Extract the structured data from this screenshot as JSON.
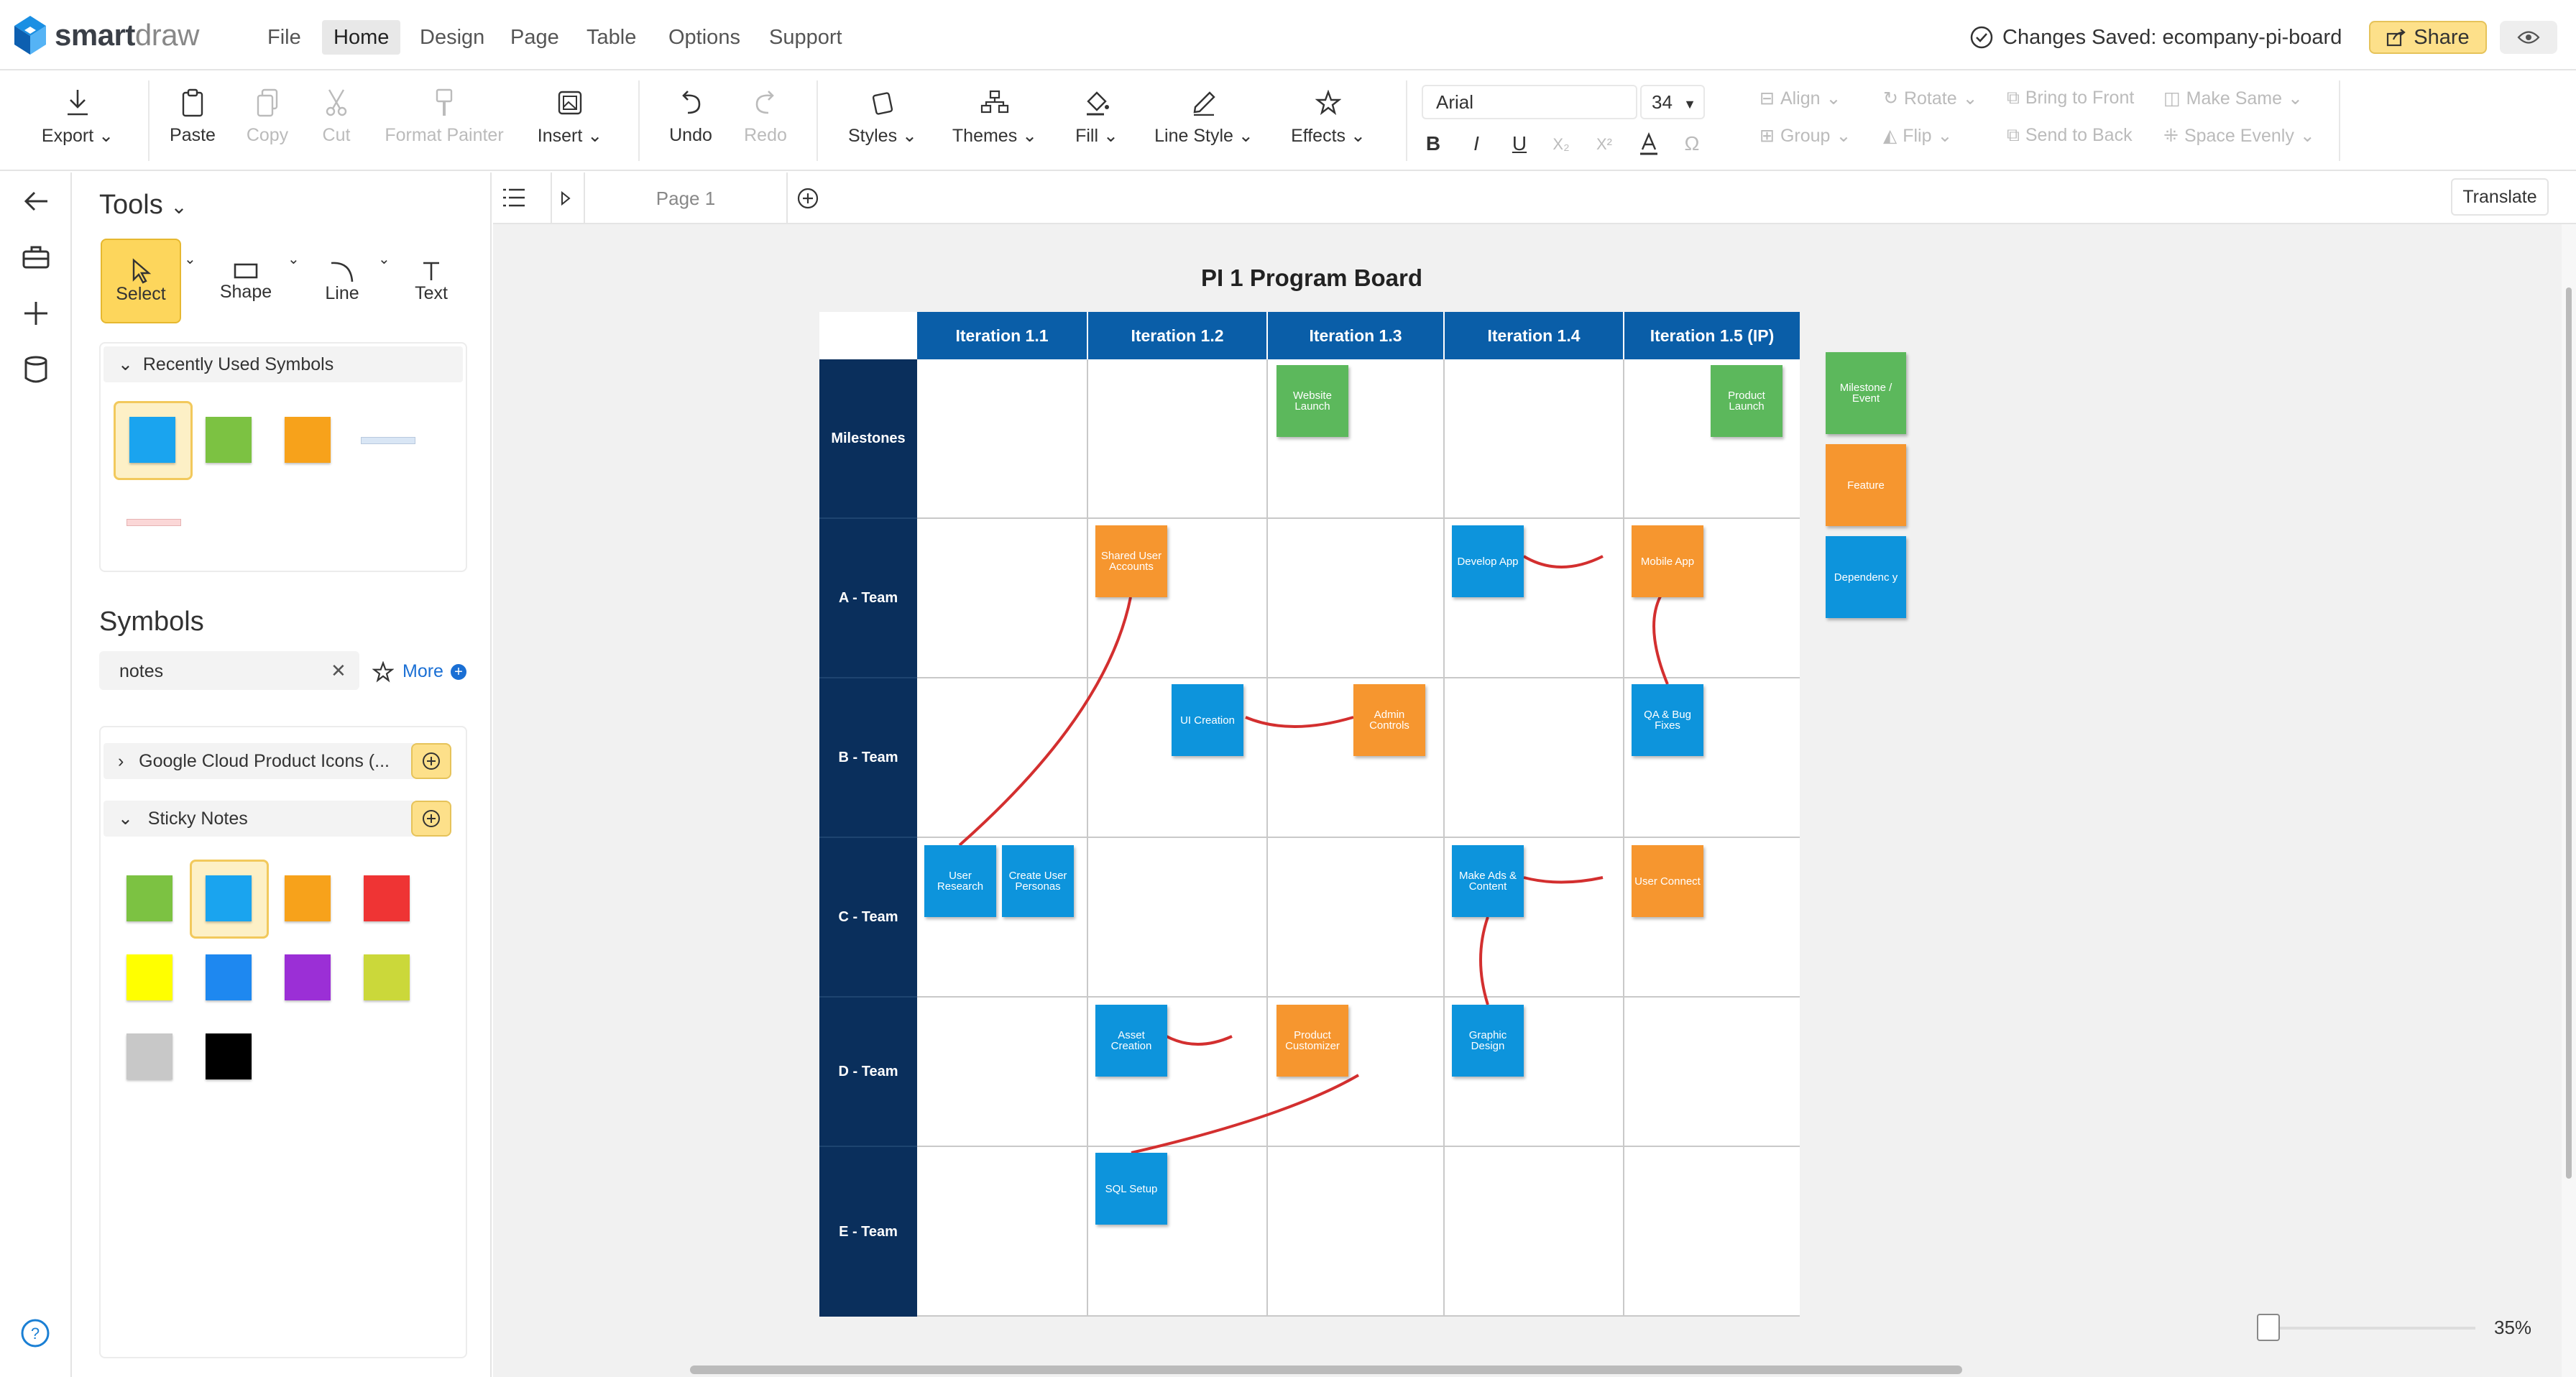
{
  "app": {
    "brand_bold": "smart",
    "brand_light": "draw"
  },
  "menu": [
    "File",
    "Home",
    "Design",
    "Page",
    "Table",
    "Options",
    "Support"
  ],
  "status": {
    "saved_text": "Changes Saved: ecompany-pi-board",
    "share_label": "Share"
  },
  "toolbar": {
    "export": "Export",
    "paste": "Paste",
    "copy": "Copy",
    "cut": "Cut",
    "format_painter": "Format Painter",
    "insert": "Insert",
    "undo": "Undo",
    "redo": "Redo",
    "styles": "Styles",
    "themes": "Themes",
    "fill": "Fill",
    "line_style": "Line Style",
    "effects": "Effects",
    "font_family": "Arial",
    "font_size": "34",
    "align": "Align",
    "rotate": "Rotate",
    "bring_front": "Bring to Front",
    "make_same": "Make Same",
    "group": "Group",
    "flip": "Flip",
    "send_back": "Send to Back",
    "space_evenly": "Space Evenly"
  },
  "panel": {
    "tools_title": "Tools",
    "tools": [
      "Select",
      "Shape",
      "Line",
      "Text"
    ],
    "recent_title": "Recently Used Symbols",
    "symbols_title": "Symbols",
    "search_value": "notes",
    "more_label": "More",
    "lib1": "Google Cloud Product Icons (...",
    "lib2": "Sticky Notes",
    "note_colors": [
      "#7cc242",
      "#1aa4ef",
      "#f7a21b",
      "#ef3434",
      "#ffff00",
      "#1e88f0",
      "#9b2fd6",
      "#cbd83a",
      "#c8c8c8",
      "#000000"
    ],
    "recent_colors": [
      "#1aa4ef",
      "#7cc242",
      "#f7a21b"
    ]
  },
  "tabs": {
    "page_label": "Page 1",
    "translate": "Translate"
  },
  "board": {
    "title": "PI 1 Program Board",
    "columns": [
      "Iteration 1.1",
      "Iteration 1.2",
      "Iteration 1.3",
      "Iteration 1.4",
      "Iteration 1.5 (IP)"
    ],
    "rows": [
      "Milestones",
      "A - Team",
      "B - Team",
      "C - Team",
      "D - Team",
      "E - Team"
    ],
    "stickies": {
      "website_launch": "Website Launch",
      "product_launch": "Product Launch",
      "shared_user_accounts": "Shared User Accounts",
      "develop_app": "Develop App",
      "mobile_app": "Mobile App",
      "ui_creation": "UI Creation",
      "admin_controls": "Admin Controls",
      "qa_bug_fixes": "QA & Bug Fixes",
      "user_research": "User Research",
      "create_user_personas": "Create User Personas",
      "make_ads_content": "Make Ads & Content",
      "user_connect": "User Connect",
      "asset_creation": "Asset Creation",
      "product_customizer": "Product Customizer",
      "graphic_design": "Graphic Design",
      "sql_setup": "SQL Setup"
    },
    "legend": [
      "Milestone / Event",
      "Feature",
      "Dependenc y"
    ]
  },
  "zoom": {
    "value": "35%",
    "level": 0.35
  },
  "colors": {
    "accent": "#fdd65c",
    "header_blue": "#0a5ea8",
    "row_navy": "#0a2f5c",
    "connector": "#d32f2f"
  }
}
